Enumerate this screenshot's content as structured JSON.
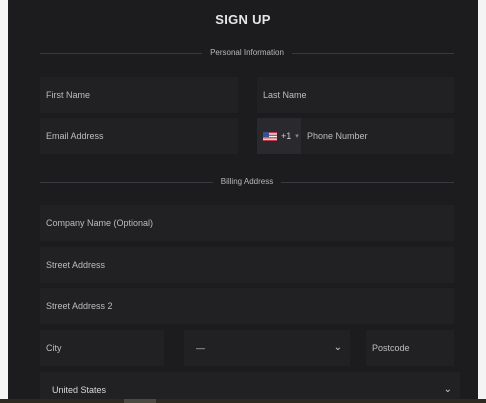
{
  "form": {
    "title": "SIGN UP",
    "personal_section": "Personal Information",
    "billing_section": "Billing Address",
    "first_name_placeholder": "First Name",
    "last_name_placeholder": "Last Name",
    "email_placeholder": "Email Address",
    "phone_code": "+1",
    "phone_placeholder": "Phone Number",
    "company_placeholder": "Company Name (Optional)",
    "street_placeholder": "Street Address",
    "street2_placeholder": "Street Address 2",
    "city_placeholder": "City",
    "state_value": "—",
    "postcode_placeholder": "Postcode",
    "country_value": "United States"
  },
  "icons": {
    "flag": "us-flag-icon",
    "caret": "caret-down-icon",
    "chevron": "chevron-down-icon"
  },
  "colors": {
    "panel": "#1c1c1e",
    "field": "#212124",
    "text": "#bdbdbd"
  }
}
